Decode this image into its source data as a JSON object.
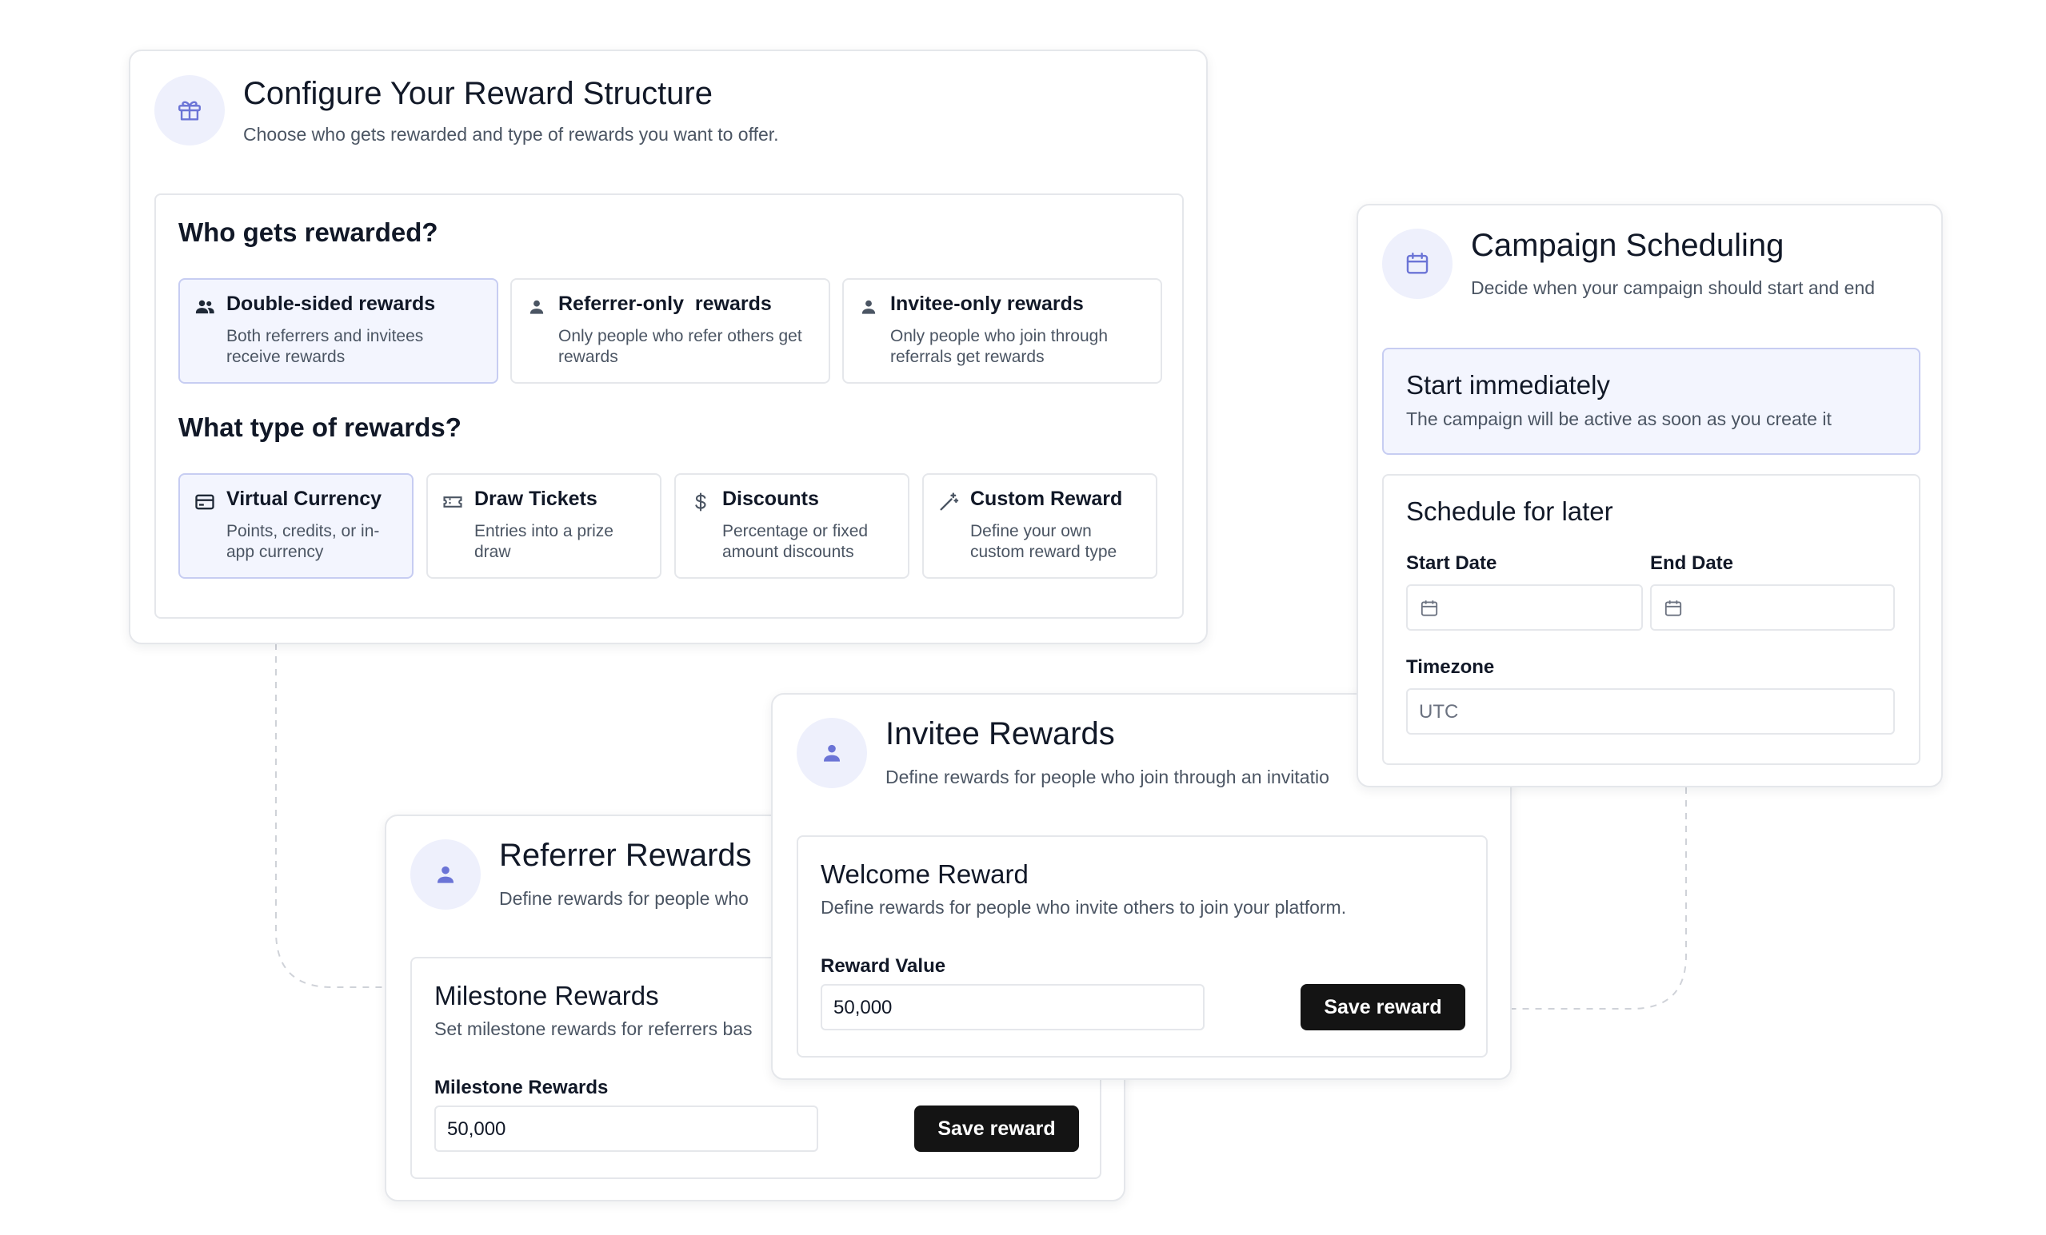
{
  "reward_config": {
    "title": "Configure Your Reward Structure",
    "subtitle": "Choose who gets rewarded and type of rewards you want to offer.",
    "icon": "gift-icon",
    "who_heading": "Who gets rewarded?",
    "who_options": [
      {
        "title": "Double-sided rewards",
        "desc": "Both referrers and invitees receive rewards",
        "icon": "users-icon",
        "selected": true
      },
      {
        "title": "Referrer-only  rewards",
        "desc": "Only people who refer others get rewards",
        "icon": "user-icon",
        "selected": false
      },
      {
        "title": "Invitee-only rewards",
        "desc": "Only people who join through referrals get rewards",
        "icon": "user-icon",
        "selected": false
      }
    ],
    "type_heading": "What type of rewards?",
    "type_options": [
      {
        "title": "Virtual Currency",
        "desc": "Points, credits, or in-app currency",
        "icon": "card-icon",
        "selected": true
      },
      {
        "title": "Draw Tickets",
        "desc": "Entries into a prize draw",
        "icon": "ticket-icon",
        "selected": false
      },
      {
        "title": "Discounts",
        "desc": "Percentage or fixed amount discounts",
        "icon": "dollar-icon",
        "selected": false
      },
      {
        "title": "Custom Reward",
        "desc": "Define your own custom reward type",
        "icon": "wand-icon",
        "selected": false
      }
    ]
  },
  "scheduling": {
    "title": "Campaign Scheduling",
    "subtitle": "Decide when your campaign should start and end",
    "icon": "calendar-icon",
    "immediate_title": "Start immediately",
    "immediate_desc": "The campaign will be active as soon as you create it",
    "later_title": "Schedule for later",
    "start_label": "Start Date",
    "end_label": "End Date",
    "timezone_label": "Timezone",
    "timezone_value": "UTC"
  },
  "invitee": {
    "title": "Invitee Rewards",
    "subtitle": "Define rewards for people who join through an invitatio",
    "icon": "user-icon",
    "section_title": "Welcome Reward",
    "section_desc": "Define rewards for people who invite others to join your platform.",
    "field_label": "Reward Value",
    "field_value": "50,000",
    "button": "Save reward"
  },
  "referrer": {
    "title": "Referrer Rewards",
    "subtitle": "Define rewards for people who",
    "icon": "user-icon",
    "section_title": "Milestone Rewards",
    "section_desc": "Set milestone rewards for referrers bas",
    "field_label": "Milestone Rewards",
    "field_value": "50,000",
    "button": "Save reward"
  },
  "colors": {
    "accent": "#6b74d6",
    "icon_bg": "#eef0fc",
    "selected_bg": "#f3f5fe",
    "button_bg": "#141414"
  }
}
